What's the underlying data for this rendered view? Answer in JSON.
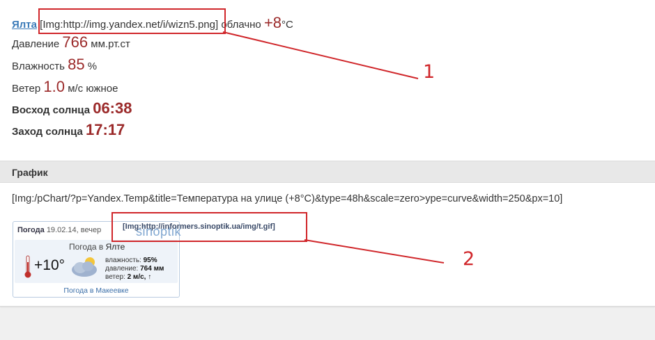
{
  "weather": {
    "city": "Ялта",
    "icon_placeholder": "[Img:http://img.yandex.net/i/wizn5.png]",
    "condition": "облачно",
    "temp": "+8",
    "temp_unit": "°C",
    "pressure_label": "Давление",
    "pressure_value": "766",
    "pressure_unit": "мм.рт.ст",
    "humidity_label": "Влажность",
    "humidity_value": "85",
    "humidity_unit": "%",
    "wind_label": "Ветер",
    "wind_value": "1.0",
    "wind_unit": "м/с южное",
    "sunrise_label": "Восход солнца",
    "sunrise_value": "06:38",
    "sunset_label": "Заход солнца",
    "sunset_value": "17:17"
  },
  "graph": {
    "title": "График",
    "chart_placeholder": "[Img:/pChart/?p=Yandex.Temp&title=Температура на улице (+8°C)&type=48h&scale=zero>ype=curve&width=250&px=10]"
  },
  "widget": {
    "header_label": "Погода",
    "header_date": "19.02.14, вечер",
    "logo": "sinoptik",
    "title_prefix": "Погода в",
    "title_city": "Ялте",
    "temp": "+10°",
    "humidity_label": "влажность:",
    "humidity_value": "95%",
    "pressure_label": "давление:",
    "pressure_value": "764 мм",
    "wind_label": "ветер:",
    "wind_value": "2 м/с, ↑",
    "footer_link": "Погода в Макеевке",
    "image_placeholder": "[Img:http://informers.sinoptik.ua/img/t.gif]"
  },
  "annotations": {
    "label_1": "1",
    "label_2": "2",
    "color": "#d0262a"
  },
  "icons": [
    "thermometer-icon",
    "cloudy-weather-icon"
  ]
}
